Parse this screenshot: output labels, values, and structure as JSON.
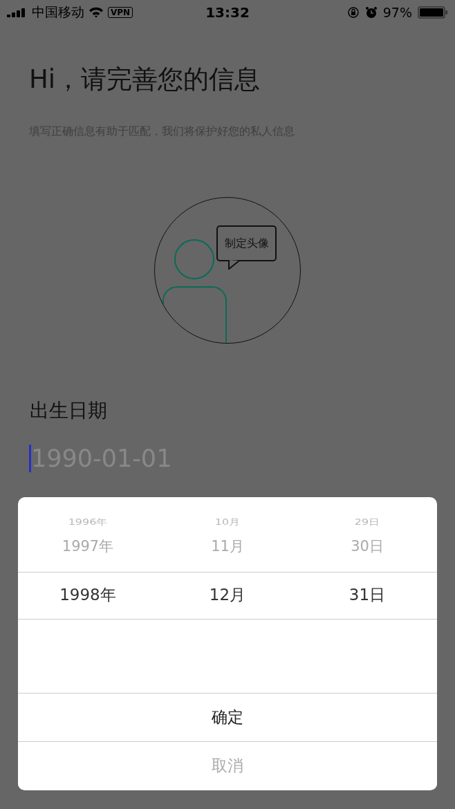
{
  "status_bar": {
    "carrier": "中国移动",
    "vpn": "VPN",
    "time": "13:32",
    "battery": "97%"
  },
  "title": "Hi，请完善您的信息",
  "subtitle": "填写正确信息有助于匹配，我们将保护好您的私人信息",
  "avatar": {
    "bubble": "制定头像"
  },
  "birth_date": {
    "label": "出生日期",
    "placeholder": "1990-01-01"
  },
  "picker": {
    "columns": [
      {
        "items": [
          {
            "label": "1996年",
            "selected": false
          },
          {
            "label": "1997年",
            "selected": false
          },
          {
            "label": "1998年",
            "selected": true
          }
        ]
      },
      {
        "items": [
          {
            "label": "10月",
            "selected": false
          },
          {
            "label": "11月",
            "selected": false
          },
          {
            "label": "12月",
            "selected": true
          }
        ]
      },
      {
        "items": [
          {
            "label": "29日",
            "selected": false
          },
          {
            "label": "30日",
            "selected": false
          },
          {
            "label": "31日",
            "selected": true
          }
        ]
      }
    ],
    "buttons": [
      {
        "label": "确定",
        "disabled": false
      },
      {
        "label": "取消",
        "disabled": true
      }
    ]
  }
}
